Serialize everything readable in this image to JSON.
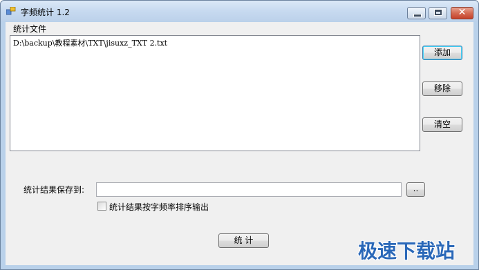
{
  "window": {
    "title": "字频统计 1.2",
    "close_glyph": "✕"
  },
  "files_group": {
    "label": "统计文件",
    "items": [
      "D:\\backup\\教程素材\\TXT\\jisuxz_TXT 2.txt"
    ]
  },
  "side_buttons": {
    "add_label": "添加",
    "remove_label": "移除",
    "clear_label": "清空"
  },
  "output": {
    "save_label": "统计结果保存到:",
    "save_value": "",
    "browse_label": "..",
    "sort_checkbox_label": "统计结果按字频率排序输出",
    "sort_checked": false
  },
  "run_button_label": "统 计",
  "watermark": "极速下载站",
  "colors": {
    "title_bar": "#c7daf0",
    "close_button": "#d46a52",
    "watermark": "#2a68b8"
  }
}
